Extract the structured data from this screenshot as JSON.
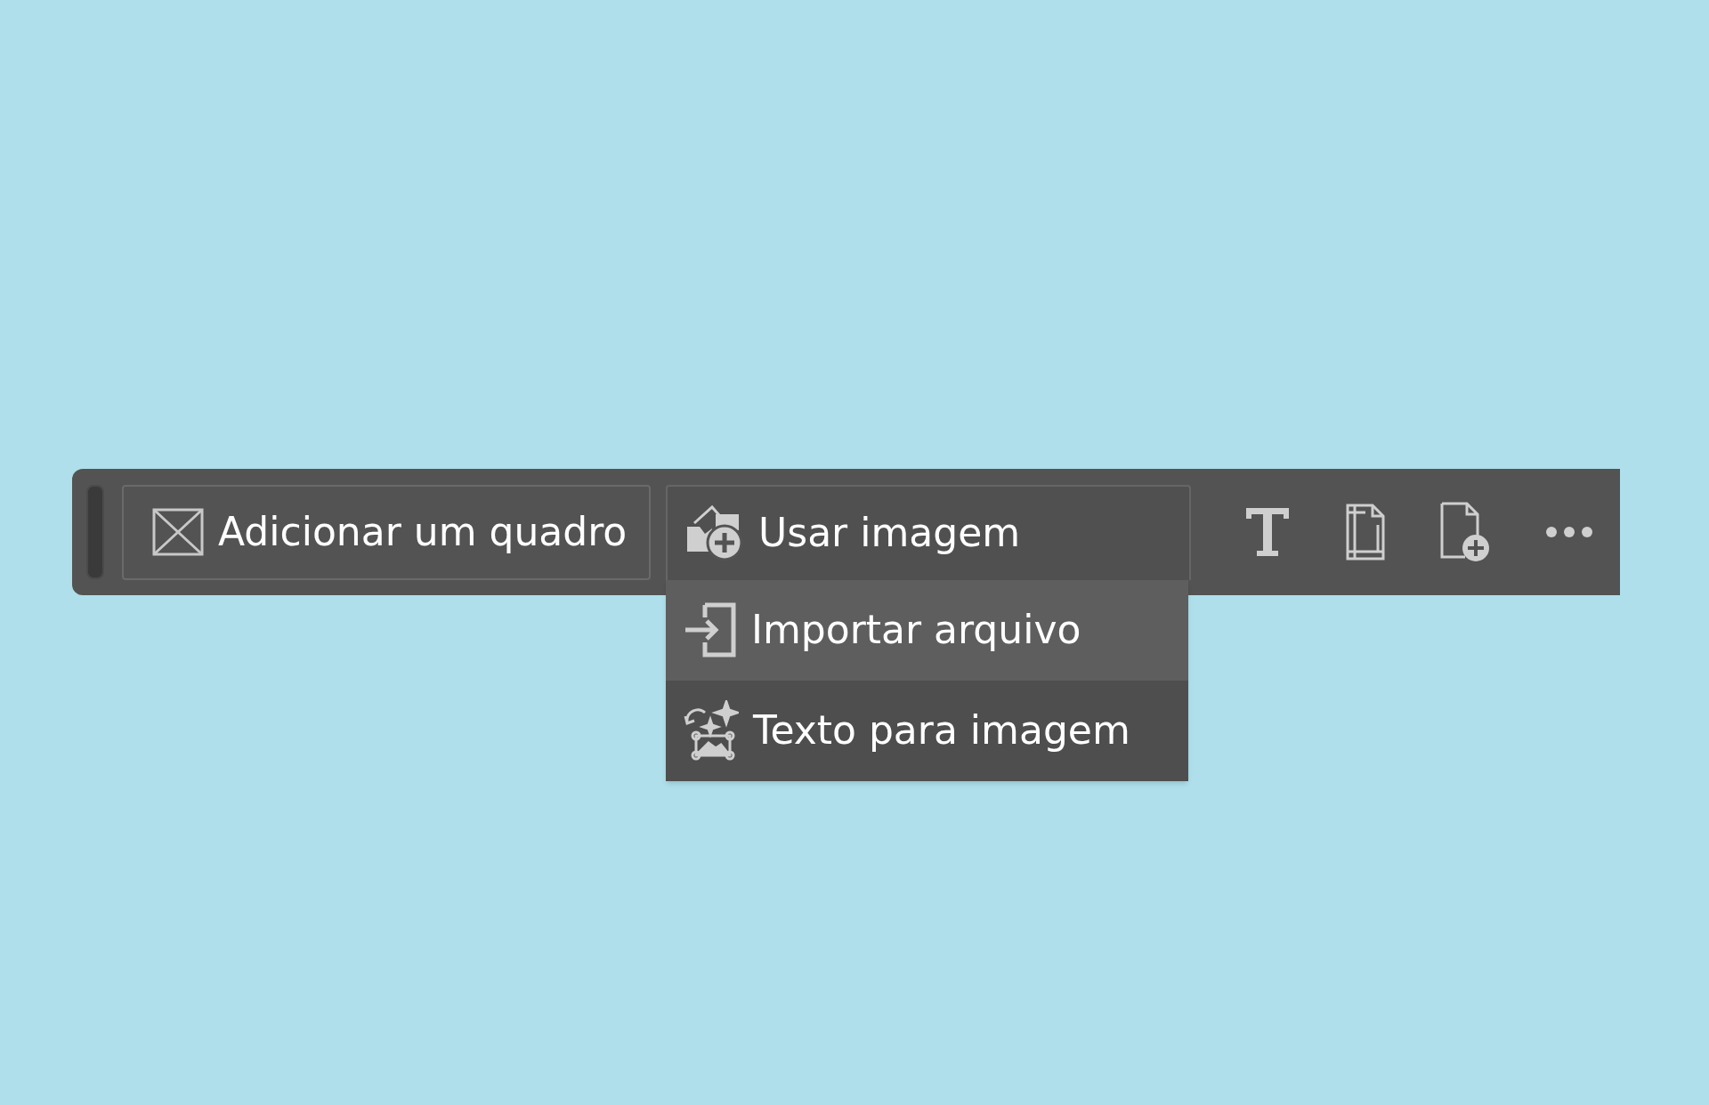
{
  "toolbar": {
    "buttons": [
      {
        "label": "Adicionar um quadro",
        "expanded": false
      },
      {
        "label": "Usar imagem",
        "expanded": true
      }
    ]
  },
  "menu": {
    "items": [
      {
        "label": "Importar arquivo",
        "selected": true
      },
      {
        "label": "Texto para imagem",
        "selected": false
      }
    ]
  }
}
